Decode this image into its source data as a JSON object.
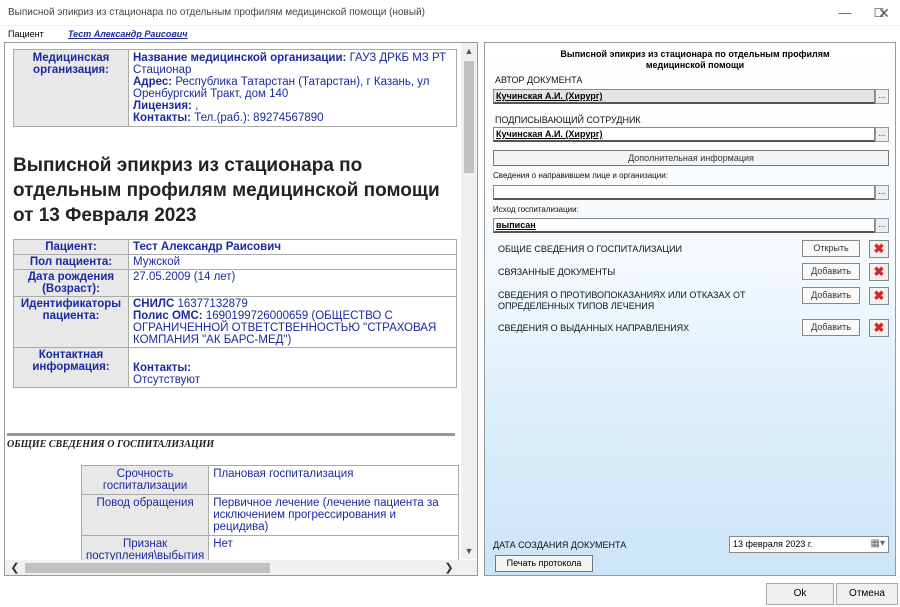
{
  "window": {
    "title": "Выписной эпикриз из стационара по отдельным профилям медицинской помощи (новый)",
    "minimize_glyph": "—",
    "maximize_glyph": "☐",
    "close_glyph": "✕"
  },
  "patient_bar": {
    "label": "Пациент",
    "value": "Тест Александр Раисович"
  },
  "document": {
    "org_table": {
      "key": "Медицинская организация:",
      "name_label": "Название медицинской организации:",
      "name_value": "ГАУЗ ДРКБ МЗ РТ Стационар",
      "address_label": "Адрес:",
      "address_value": "Республика Татарстан (Татарстан), г Казань, ул Оренбургский Тракт, дом 140",
      "license_label": "Лицензия:",
      "license_value": ",",
      "contacts_label": "Контакты:",
      "contacts_value": "Тел.(раб.): 89274567890"
    },
    "title": "Выписной эпикриз из стационара по отдельным профилям медицинской помощи от 13 Февраля 2023",
    "patient_table": {
      "patient_key": "Пациент:",
      "patient_value": "Тест Александр Раисович",
      "sex_key": "Пол пациента:",
      "sex_value": "Мужской",
      "dob_key": "Дата рождения (Возраст):",
      "dob_value": "27.05.2009 (14 лет)",
      "ids_key": "Идентификаторы пациента:",
      "snils_label": "СНИЛС",
      "snils_value": "16377132879",
      "oms_label": "Полис ОМС:",
      "oms_value": "1690199726000659 (ОБЩЕСТВО С ОГРАНИЧЕННОЙ ОТВЕТСТВЕННОСТЬЮ \"СТРАХОВАЯ КОМПАНИЯ \"АК БАРС-МЕД\")",
      "contact_key": "Контактная информация:",
      "contacts_label": "Контакты:",
      "contacts_value": "Отсутствуют"
    },
    "section_header": "ОБЩИЕ СВЕДЕНИЯ О ГОСПИТАЛИЗАЦИИ",
    "general_table": [
      {
        "key": "Срочность госпитализации",
        "value": "Плановая госпитализация"
      },
      {
        "key": "Повод обращения",
        "value": "Первичное лечение (лечение пациента за исключением прогрессирования и рецидива)"
      },
      {
        "key": "Признак поступления\\выбытия",
        "value": "Нет"
      }
    ]
  },
  "form": {
    "title": "Выписной эпикриз из стационара по отдельным профилям медицинской помощи",
    "author_label": "АВТОР ДОКУМЕНТА",
    "author_value": "Кучинская А.И. (Хирург)",
    "signer_label": "ПОДПИСЫВАЮЩИЙ СОТРУДНИК",
    "signer_value": "Кучинская А.И. (Хирург)",
    "extra_info_button": "Дополнительная информация",
    "referral_label": "Сведения о направившем лице и организации:",
    "referral_value": "",
    "outcome_label": "Исход госпитализации:",
    "outcome_value": "выписан",
    "dots": "...",
    "rows": [
      {
        "label": "ОБЩИЕ СВЕДЕНИЯ О ГОСПИТАЛИЗАЦИИ",
        "button": "Открыть"
      },
      {
        "label": "СВЯЗАННЫЕ ДОКУМЕНТЫ",
        "button": "Добавить"
      },
      {
        "label": "СВЕДЕНИЯ О ПРОТИВОПОКАЗАНИЯХ ИЛИ ОТКАЗАХ ОТ ОПРЕДЕЛЕННЫХ ТИПОВ ЛЕЧЕНИЯ",
        "button": "Добавить"
      },
      {
        "label": "СВЕДЕНИЯ О ВЫДАННЫХ НАПРАВЛЕНИЯХ",
        "button": "Добавить"
      }
    ],
    "delete_glyph": "✖",
    "creation_date_label": "ДАТА СОЗДАНИЯ ДОКУМЕНТА",
    "creation_date_value": "13 февраля  2023 г.",
    "calendar_glyph": "▦▾",
    "print_button": "Печать протокола"
  },
  "footer": {
    "ok": "Ok",
    "cancel": "Отмена"
  },
  "scroll_glyphs": {
    "up": "▲",
    "down": "▼",
    "left": "❮",
    "right": "❯"
  }
}
